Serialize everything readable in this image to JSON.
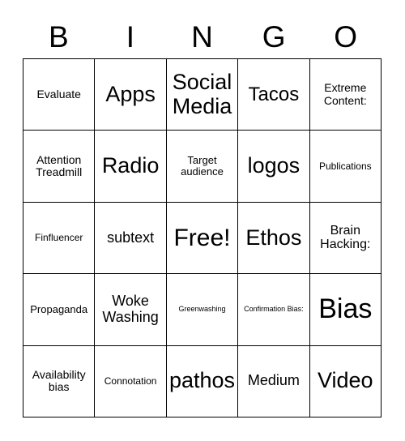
{
  "card": {
    "title": "BINGO",
    "header_letters": [
      "B",
      "I",
      "N",
      "G",
      "O"
    ],
    "colors": {
      "background": "#ffffff",
      "text": "#000000",
      "grid_line": "#000000"
    },
    "grid": {
      "columns": 5,
      "rows": 5,
      "cells": [
        {
          "text": "Evaluate",
          "size": "fs-sm"
        },
        {
          "text": "Apps",
          "size": "fs-xxl"
        },
        {
          "text": "Social Media",
          "size": "fs-xxl"
        },
        {
          "text": "Tacos",
          "size": "fs-xl"
        },
        {
          "text": "Extreme Content:",
          "size": "fs-sm"
        },
        {
          "text": "Attention Treadmill",
          "size": "fs-sm"
        },
        {
          "text": "Radio",
          "size": "fs-xxl"
        },
        {
          "text": "Target audience",
          "size": "fs-s"
        },
        {
          "text": "logos",
          "size": "fs-xxl"
        },
        {
          "text": "Publications",
          "size": "fs-xs"
        },
        {
          "text": "Finfluencer",
          "size": "fs-xs"
        },
        {
          "text": "subtext",
          "size": "fs-ml"
        },
        {
          "text": "Free!",
          "size": "fs-3xl"
        },
        {
          "text": "Ethos",
          "size": "fs-xxl"
        },
        {
          "text": "Brain Hacking:",
          "size": "fs-m"
        },
        {
          "text": "Propaganda",
          "size": "fs-s"
        },
        {
          "text": "Woke Washing",
          "size": "fs-ml"
        },
        {
          "text": "Greenwashing",
          "size": "fs-xxs"
        },
        {
          "text": "Confirmation Bias:",
          "size": "fs-xxs"
        },
        {
          "text": "Bias",
          "size": "fs-4xl"
        },
        {
          "text": "Availability bias",
          "size": "fs-sm"
        },
        {
          "text": "Connotation",
          "size": "fs-xs"
        },
        {
          "text": "pathos",
          "size": "fs-xxl"
        },
        {
          "text": "Medium",
          "size": "fs-ml"
        },
        {
          "text": "Video",
          "size": "fs-xxl"
        }
      ]
    }
  }
}
